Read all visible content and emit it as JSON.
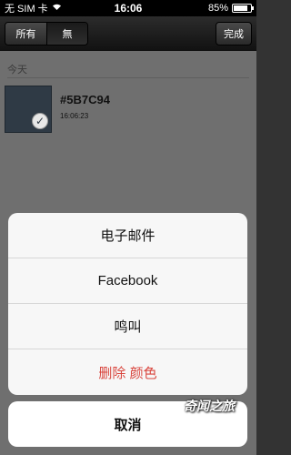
{
  "status_bar": {
    "carrier": "无 SIM 卡",
    "time": "16:06",
    "battery_text": "85%",
    "battery_level": 0.85
  },
  "toolbar": {
    "filter_all": "所有",
    "filter_none": "無",
    "done": "完成"
  },
  "list": {
    "section_title": "今天",
    "items": [
      {
        "hex": "#5B7C94",
        "time": "16:06:23",
        "swatch_color": "#2f3a45"
      }
    ]
  },
  "action_sheet": {
    "options": [
      "电子邮件",
      "Facebook",
      "鸣叫",
      "删除 颜色"
    ],
    "cancel": "取消"
  },
  "watermark": "奇闻之旅",
  "colors": {
    "destructive": "#d9463e",
    "background": "#6f6f6f"
  }
}
